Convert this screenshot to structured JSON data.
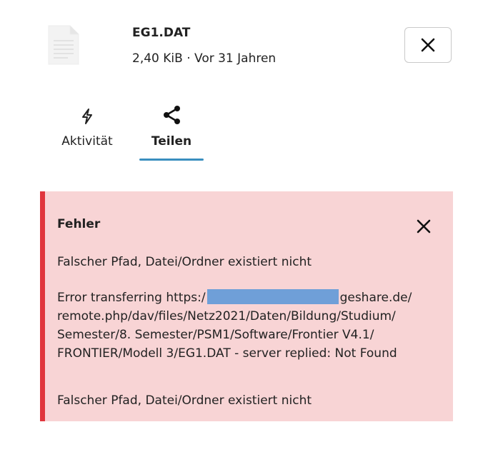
{
  "file": {
    "name": "EG1.DAT",
    "size": "2,40 KiB",
    "separator": " · ",
    "age": "Vor 31 Jahren",
    "thumbnail_icon": "document-icon"
  },
  "header": {
    "close_icon": "close-icon"
  },
  "tabs": [
    {
      "label": "Aktivität",
      "icon": "lightning-icon",
      "active": false
    },
    {
      "label": "Teilen",
      "icon": "share-icon",
      "active": true
    }
  ],
  "error": {
    "title": "Fehler",
    "message_1": "Falscher Pfad, Datei/Ordner existiert nicht",
    "detail_line_1_prefix": "Error transferring https:/",
    "detail_line_1_suffix": "geshare.de/",
    "detail_line_2": "remote.php/dav/files/Netz2021/Daten/Bildung/Studium/",
    "detail_line_3": "Semester/8. Semester/PSM1/Software/Frontier V4.1/",
    "detail_line_4": "FRONTIER/Modell 3/EG1.DAT - server replied: Not Found",
    "message_2": "Falscher Pfad, Datei/Ordner existiert nicht",
    "colors": {
      "background": "#f8d4d5",
      "accent": "#e0363d",
      "redaction": "#6f9fd8"
    }
  },
  "colors": {
    "active_tab_underline": "#3a8fbf"
  }
}
